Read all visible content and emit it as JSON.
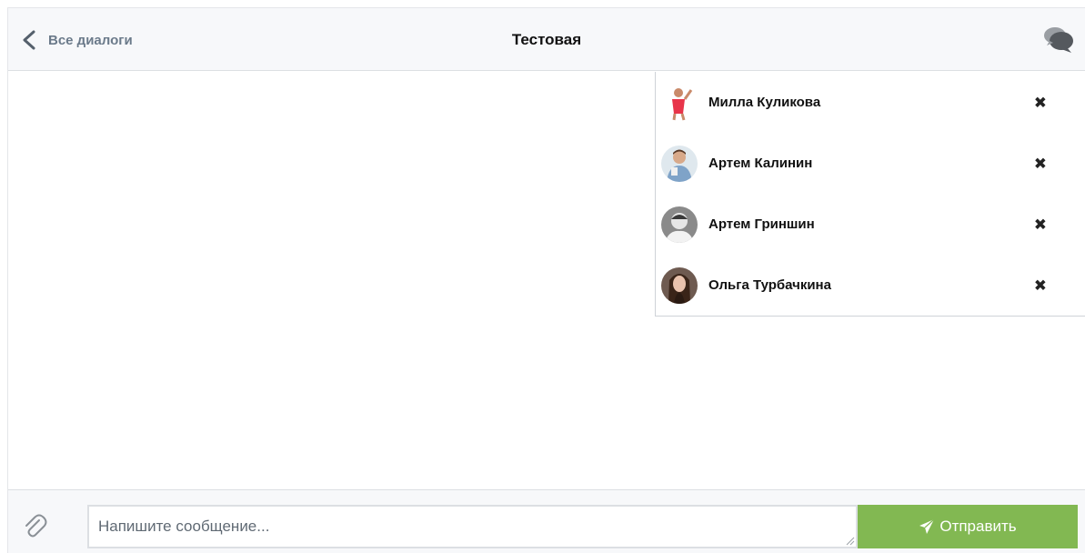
{
  "header": {
    "back_label": "Все диалоги",
    "title": "Тестовая"
  },
  "members": [
    {
      "name": "Милла Куликова",
      "remove": "✖",
      "avatar": "avatar-milla"
    },
    {
      "name": "Артем Калинин",
      "remove": "✖",
      "avatar": "avatar-artem-k"
    },
    {
      "name": "Артем Гриншин",
      "remove": "✖",
      "avatar": "avatar-artem-g"
    },
    {
      "name": "Ольга Турбачкина",
      "remove": "✖",
      "avatar": "avatar-olga"
    }
  ],
  "composer": {
    "placeholder": "Напишите сообщение...",
    "send_label": "Отправить"
  },
  "icons": {
    "back": "chevron-left-icon",
    "chat": "chat-bubbles-icon",
    "attach": "paperclip-icon",
    "send": "paper-plane-icon",
    "remove": "close-icon"
  },
  "colors": {
    "send_button": "#82b852",
    "header_bg": "#f7f8fa",
    "back_label": "#6b7a8a"
  }
}
